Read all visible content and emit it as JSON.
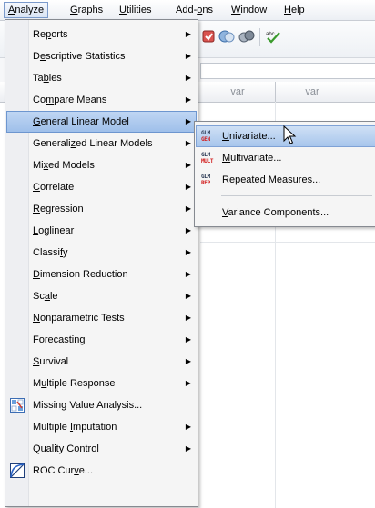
{
  "menubar": {
    "items": [
      {
        "label_pre": "",
        "mnemonic": "A",
        "label_post": "nalyze",
        "active": true
      },
      {
        "label_pre": "",
        "mnemonic": "G",
        "label_post": "raphs"
      },
      {
        "label_pre": "",
        "mnemonic": "U",
        "label_post": "tilities"
      },
      {
        "label_pre": "Add-",
        "mnemonic": "o",
        "label_post": "ns"
      },
      {
        "label_pre": "",
        "mnemonic": "W",
        "label_post": "indow"
      },
      {
        "label_pre": "",
        "mnemonic": "H",
        "label_post": "elp"
      }
    ]
  },
  "grid": {
    "column_headers": [
      "var",
      "var"
    ]
  },
  "analyze_menu": {
    "items": [
      {
        "pre": "Re",
        "mn": "p",
        "post": "orts",
        "submenu": true
      },
      {
        "pre": "D",
        "mn": "e",
        "post": "scriptive Statistics",
        "submenu": true
      },
      {
        "pre": "Ta",
        "mn": "b",
        "post": "les",
        "submenu": true
      },
      {
        "pre": "Co",
        "mn": "m",
        "post": "pare Means",
        "submenu": true
      },
      {
        "pre": "",
        "mn": "G",
        "post": "eneral Linear Model",
        "submenu": true,
        "highlighted": true
      },
      {
        "pre": "Generali",
        "mn": "z",
        "post": "ed Linear Models",
        "submenu": true
      },
      {
        "pre": "Mi",
        "mn": "x",
        "post": "ed Models",
        "submenu": true
      },
      {
        "pre": "",
        "mn": "C",
        "post": "orrelate",
        "submenu": true
      },
      {
        "pre": "",
        "mn": "R",
        "post": "egression",
        "submenu": true
      },
      {
        "pre": "",
        "mn": "L",
        "post": "oglinear",
        "submenu": true
      },
      {
        "pre": "Classi",
        "mn": "f",
        "post": "y",
        "submenu": true
      },
      {
        "pre": "",
        "mn": "D",
        "post": "imension Reduction",
        "submenu": true
      },
      {
        "pre": "Sc",
        "mn": "a",
        "post": "le",
        "submenu": true
      },
      {
        "pre": "",
        "mn": "N",
        "post": "onparametric Tests",
        "submenu": true
      },
      {
        "pre": "Foreca",
        "mn": "s",
        "post": "ting",
        "submenu": true
      },
      {
        "pre": "",
        "mn": "S",
        "post": "urvival",
        "submenu": true
      },
      {
        "pre": "M",
        "mn": "u",
        "post": "ltiple Response",
        "submenu": true
      },
      {
        "pre": "Missing Value Analysis...",
        "mn": "",
        "post": "",
        "submenu": false,
        "icon": "missing-value-icon"
      },
      {
        "pre": "Multiple ",
        "mn": "I",
        "post": "mputation",
        "submenu": true
      },
      {
        "pre": "",
        "mn": "Q",
        "post": "uality Control",
        "submenu": true
      },
      {
        "pre": "ROC Cur",
        "mn": "v",
        "post": "e...",
        "submenu": false,
        "icon": "roc-curve-icon"
      }
    ]
  },
  "glm_submenu": {
    "items": [
      {
        "pre": "",
        "mn": "U",
        "post": "nivariate...",
        "icon_top": "GLM",
        "icon_bottom": "GEN",
        "highlighted": true
      },
      {
        "pre": "",
        "mn": "M",
        "post": "ultivariate...",
        "icon_top": "GLM",
        "icon_bottom": "MULT"
      },
      {
        "pre": "",
        "mn": "R",
        "post": "epeated Measures...",
        "icon_top": "GLM",
        "icon_bottom": "REP"
      },
      {
        "pre": "",
        "mn": "V",
        "post": "ariance Components...",
        "icon_top": "",
        "icon_bottom": ""
      }
    ]
  },
  "colors": {
    "highlight": "#9fc0ea",
    "menu_bg": "#f5f5f5",
    "glm_red": "#d21f1f"
  }
}
